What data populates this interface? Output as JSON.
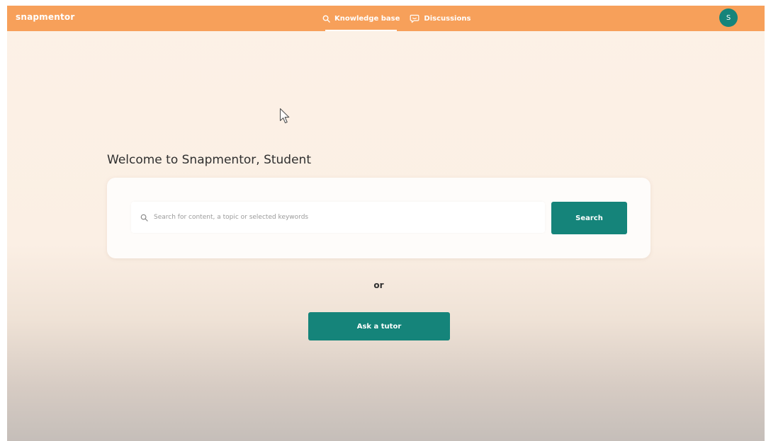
{
  "header": {
    "brand": "snapmentor",
    "nav": [
      {
        "label": "Knowledge base",
        "icon": "search-icon",
        "active": true
      },
      {
        "label": "Discussions",
        "icon": "chat-bubble-icon",
        "active": false
      }
    ],
    "avatar_initial": "S"
  },
  "main": {
    "welcome": "Welcome to Snapmentor, Student",
    "search": {
      "placeholder": "Search for content, a topic or selected keywords",
      "value": "",
      "button_label": "Search"
    },
    "or_label": "or",
    "ask_label": "Ask a tutor"
  },
  "colors": {
    "header_orange": "#f7a05a",
    "accent_teal": "#15847a",
    "background_cream": "#fcf1e6"
  }
}
